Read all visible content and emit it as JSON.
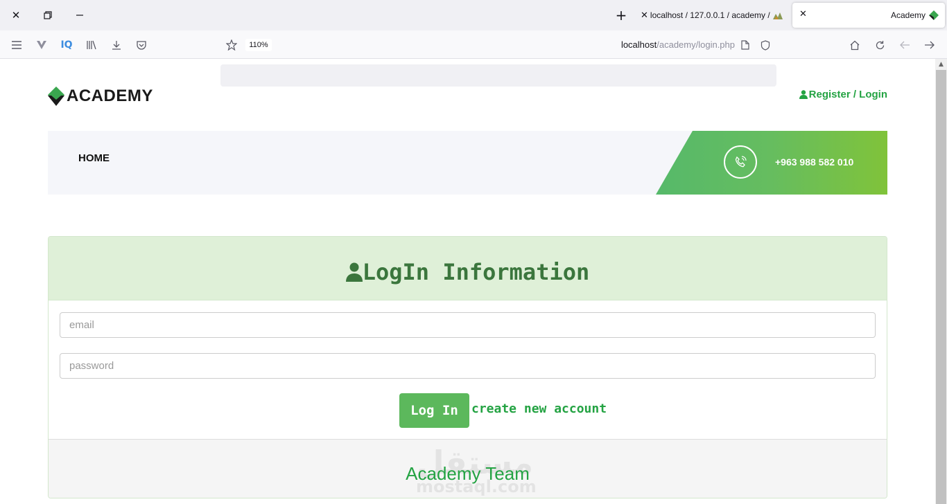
{
  "browser": {
    "tabs": [
      {
        "label": "localhost / 127.0.0.1 / academy /",
        "active": false
      },
      {
        "label": "Academy",
        "active": true
      }
    ],
    "zoom": "110%",
    "url": {
      "host": "localhost",
      "path": "/academy/login.php"
    },
    "toolbar_icons": [
      "menu-icon",
      "extension-icon",
      "iq-icon",
      "library-icon",
      "download-icon",
      "pocket-icon",
      "bookmark-star-icon",
      "page-icon",
      "shield-icon",
      "home-icon",
      "reload-icon",
      "back-icon",
      "forward-icon"
    ],
    "iq_label": "IQ"
  },
  "header": {
    "logo_text": "ACADEMY",
    "register_link": "Register / Login"
  },
  "nav": {
    "home": "HOME",
    "phone": "+963 988 582 010"
  },
  "login": {
    "title": "LogIn Information",
    "email_placeholder": "email",
    "password_placeholder": "password",
    "login_button": "Log In",
    "create_account_link": "create new account",
    "footer": "Academy Team"
  },
  "watermark": {
    "arabic": "مستقل",
    "latin": "mostaql.com"
  },
  "colors": {
    "brand_green": "#24a343",
    "button_green": "#5cb85c",
    "panel_head": "#dff0d8",
    "title_green": "#3b763d",
    "nav_gradient_start": "#56b96a",
    "nav_gradient_end": "#80c33a"
  }
}
